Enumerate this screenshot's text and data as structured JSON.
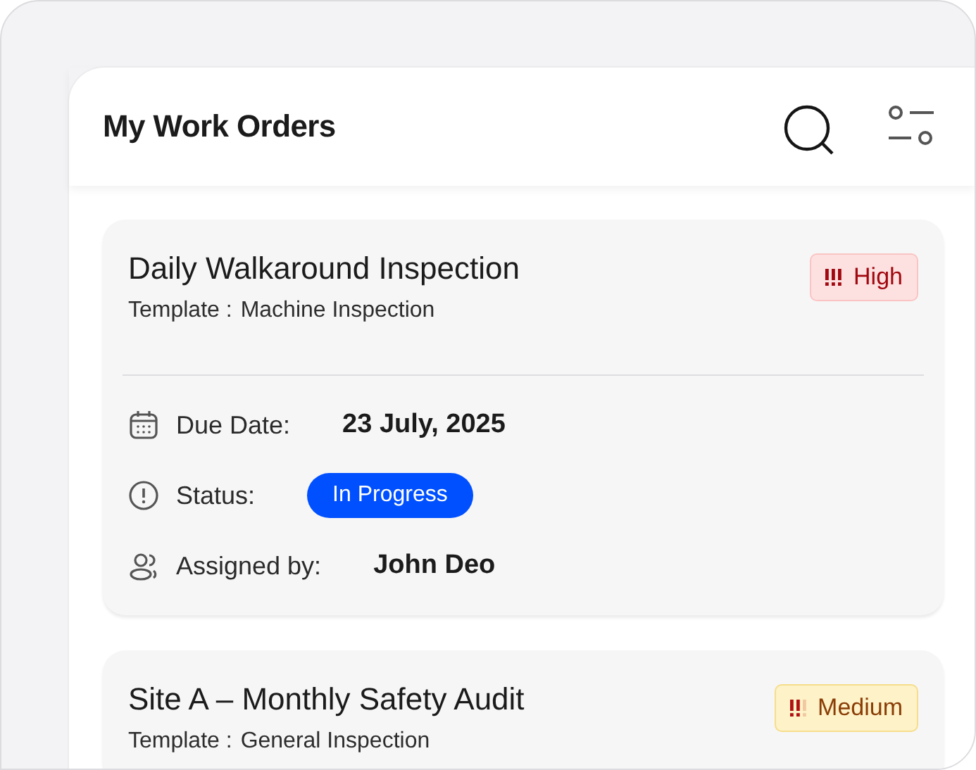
{
  "header": {
    "title": "My Work Orders"
  },
  "orders": [
    {
      "title": "Daily Walkaround Inspection",
      "template_label": "Template :",
      "template": "Machine Inspection",
      "priority": {
        "kind": "high",
        "label": "High"
      },
      "fields": [
        {
          "kind": "date",
          "label": "Due Date:",
          "value": "23 July, 2025"
        },
        {
          "kind": "status",
          "label": "Status:",
          "value": "In Progress"
        },
        {
          "kind": "person",
          "label": "Assigned by:",
          "value": "John Deo"
        }
      ]
    },
    {
      "title": "Site A – Monthly Safety Audit",
      "template_label": "Template :",
      "template": "General Inspection",
      "priority": {
        "kind": "medium",
        "label": "Medium"
      }
    }
  ]
}
